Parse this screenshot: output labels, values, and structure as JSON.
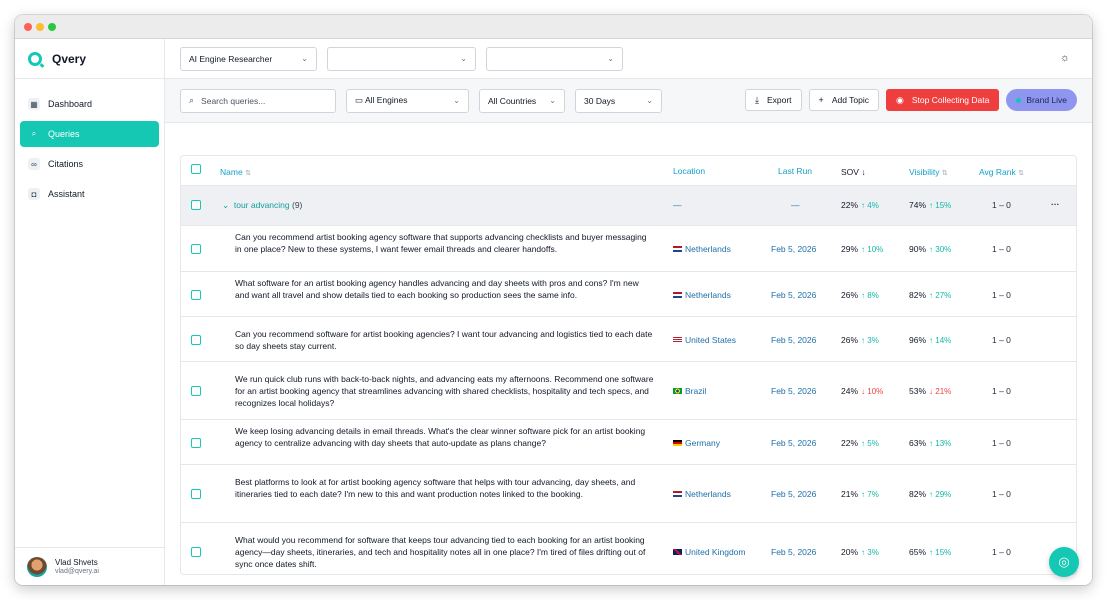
{
  "brand": {
    "name": "Qvery"
  },
  "sidebar": {
    "items": [
      {
        "label": "Dashboard",
        "icon": "grid-icon",
        "active": false
      },
      {
        "label": "Queries",
        "icon": "search-icon",
        "active": true
      },
      {
        "label": "Citations",
        "icon": "link-icon",
        "active": false
      },
      {
        "label": "Assistant",
        "icon": "bot-icon",
        "active": false
      }
    ]
  },
  "user": {
    "name": "Vlad Shvets",
    "email": "vlad@qvery.ai"
  },
  "topbar": {
    "agent_select": "AI Engine Researcher",
    "select2": "",
    "select3": ""
  },
  "filters": {
    "search_placeholder": "Search queries...",
    "engines": "All Engines",
    "countries": "All Countries",
    "range": "30 Days"
  },
  "actions": {
    "export": "Export",
    "add_topic": "Add Topic",
    "stop": "Stop Collecting Data",
    "live": "Brand Live"
  },
  "table": {
    "headers": {
      "name": "Name",
      "location": "Location",
      "last_run": "Last Run",
      "sov": "SOV",
      "visibility": "Visibility",
      "avg_rank": "Avg Rank"
    },
    "group": {
      "name": "tour advancing",
      "count": "(9)",
      "location": "—",
      "last_run": "—",
      "sov": "22%",
      "sov_delta": "↑ 4%",
      "visibility": "74%",
      "vis_delta": "↑ 15%",
      "rank": "1 – 0"
    },
    "rows": [
      {
        "query": "Can you recommend artist booking agency software that supports advancing checklists and buyer messaging in one place? New to these systems, I want fewer email threads and clearer handoffs.",
        "location": "Netherlands",
        "flag": "nl",
        "date": "Feb 5, 2026",
        "sov": "29%",
        "sov_delta": "↑ 10%",
        "sov_dir": "up",
        "vis": "90%",
        "vis_delta": "↑ 30%",
        "vis_dir": "up",
        "rank": "1 – 0"
      },
      {
        "query": "What software for an artist booking agency handles advancing and day sheets with pros and cons? I'm new and want all travel and show details tied to each booking so production sees the same info.",
        "location": "Netherlands",
        "flag": "nl",
        "date": "Feb 5, 2026",
        "sov": "26%",
        "sov_delta": "↑ 8%",
        "sov_dir": "up",
        "vis": "82%",
        "vis_delta": "↑ 27%",
        "vis_dir": "up",
        "rank": "1 – 0"
      },
      {
        "query": "Can you recommend software for artist booking agencies? I want tour advancing and logistics tied to each date so day sheets stay current.",
        "location": "United States",
        "flag": "us",
        "date": "Feb 5, 2026",
        "sov": "26%",
        "sov_delta": "↑ 3%",
        "sov_dir": "up",
        "vis": "96%",
        "vis_delta": "↑ 14%",
        "vis_dir": "up",
        "rank": "1 – 0"
      },
      {
        "query": "We run quick club runs with back-to-back nights, and advancing eats my afternoons. Recommend one software for an artist booking agency that streamlines advancing with shared checklists, hospitality and tech specs, and recognizes local holidays?",
        "location": "Brazil",
        "flag": "br",
        "date": "Feb 5, 2026",
        "sov": "24%",
        "sov_delta": "↓ 10%",
        "sov_dir": "down",
        "vis": "53%",
        "vis_delta": "↓ 21%",
        "vis_dir": "down",
        "rank": "1 – 0"
      },
      {
        "query": "We keep losing advancing details in email threads. What's the clear winner software pick for an artist booking agency to centralize advancing with day sheets that auto-update as plans change?",
        "location": "Germany",
        "flag": "de",
        "date": "Feb 5, 2026",
        "sov": "22%",
        "sov_delta": "↑ 5%",
        "sov_dir": "up",
        "vis": "63%",
        "vis_delta": "↑ 13%",
        "vis_dir": "up",
        "rank": "1 – 0"
      },
      {
        "query": "Best platforms to look at for artist booking agency software that helps with tour advancing, day sheets, and itineraries tied to each date? I'm new to this and want production notes linked to the booking.",
        "location": "Netherlands",
        "flag": "nl",
        "date": "Feb 5, 2026",
        "sov": "21%",
        "sov_delta": "↑ 7%",
        "sov_dir": "up",
        "vis": "82%",
        "vis_delta": "↑ 29%",
        "vis_dir": "up",
        "rank": "1 – 0"
      },
      {
        "query": "What would you recommend for software that keeps tour advancing tied to each booking for an artist booking agency—day sheets, itineraries, and tech and hospitality notes all in one place? I'm tired of files drifting out of sync once dates shift.",
        "location": "United Kingdom",
        "flag": "gb",
        "date": "Feb 5, 2026",
        "sov": "20%",
        "sov_delta": "↑ 3%",
        "sov_dir": "up",
        "vis": "65%",
        "vis_delta": "↑ 15%",
        "vis_dir": "up",
        "rank": "1 – 0"
      }
    ]
  },
  "colors": {
    "accent": "#14c8b4",
    "stop": "#ef3e3e",
    "live": "#8e96f0",
    "link": "#1e6fa8"
  }
}
